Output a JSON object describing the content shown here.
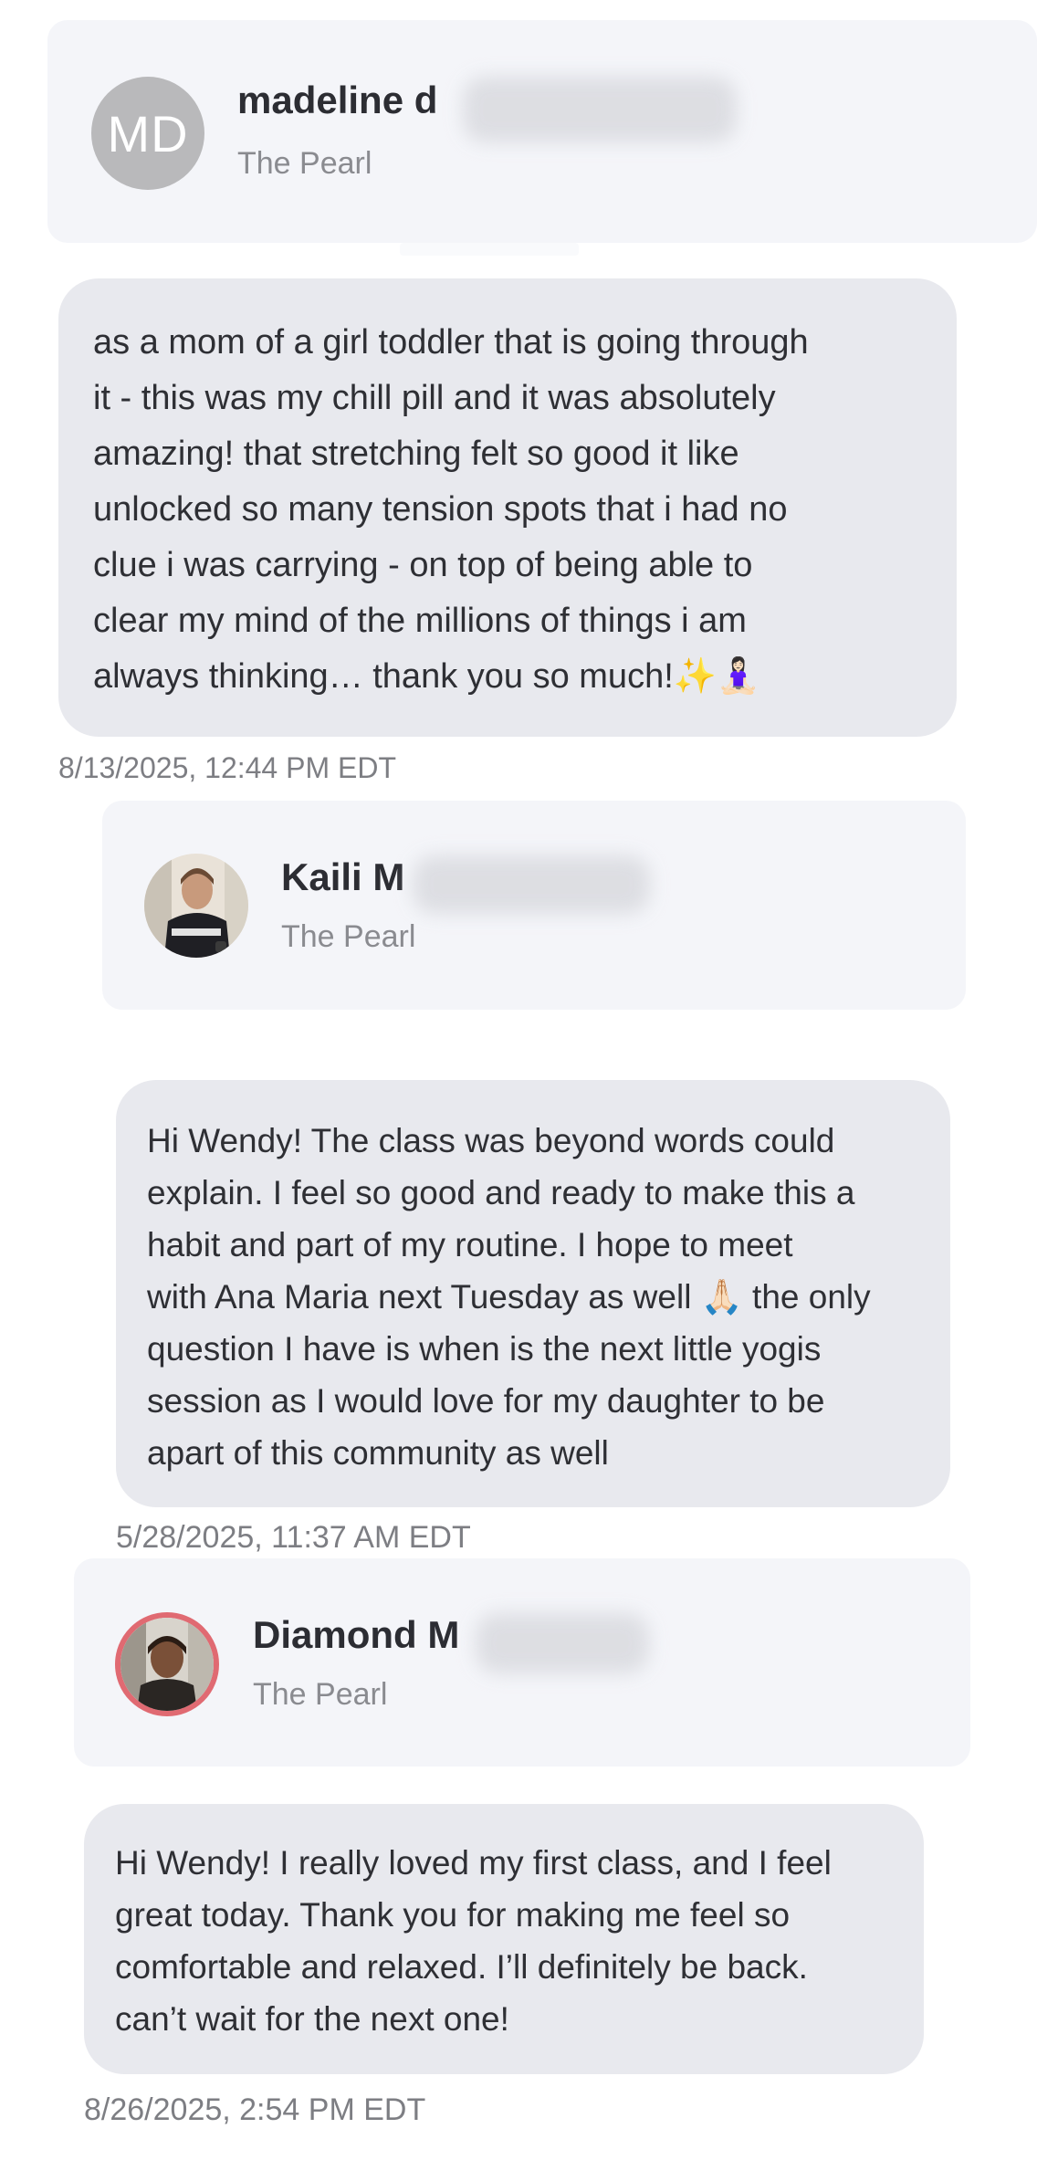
{
  "reviews": [
    {
      "author": "madeline d",
      "initials": "MD",
      "location": "The Pearl",
      "message": "as a mom of a girl toddler that is going through\nit - this was my chill pill and it was absolutely\namazing! that stretching felt so good it like\nunlocked so many tension spots that i had no\nclue i was carrying - on top of being able to\nclear my mind of the millions of things i am\nalways thinking… thank you so much!✨🧘🏻‍♀️",
      "timestamp": "8/13/2025, 12:44 PM EDT"
    },
    {
      "author": "Kaili M",
      "location": "The Pearl",
      "avatar_icon": "profile-photo",
      "message": "Hi Wendy! The class was beyond words could\nexplain. I feel so good and ready to make this a\nhabit and part of my routine. I hope to meet\nwith Ana Maria next Tuesday as well 🙏🏻 the only\nquestion I have is when is the next little yogis\nsession as I would love for my daughter to be\napart of this community as well",
      "timestamp": "5/28/2025, 11:37 AM EDT"
    },
    {
      "author": "Diamond M",
      "location": "The Pearl",
      "avatar_icon": "profile-photo",
      "avatar_ring_color": "#e06a72",
      "message": "Hi Wendy! I really loved my first class, and I feel\ngreat today. Thank you for making me feel so\ncomfortable and relaxed. I’ll definitely be back.\ncan’t wait for the next one!",
      "timestamp": "8/26/2025, 2:54 PM EDT"
    }
  ]
}
